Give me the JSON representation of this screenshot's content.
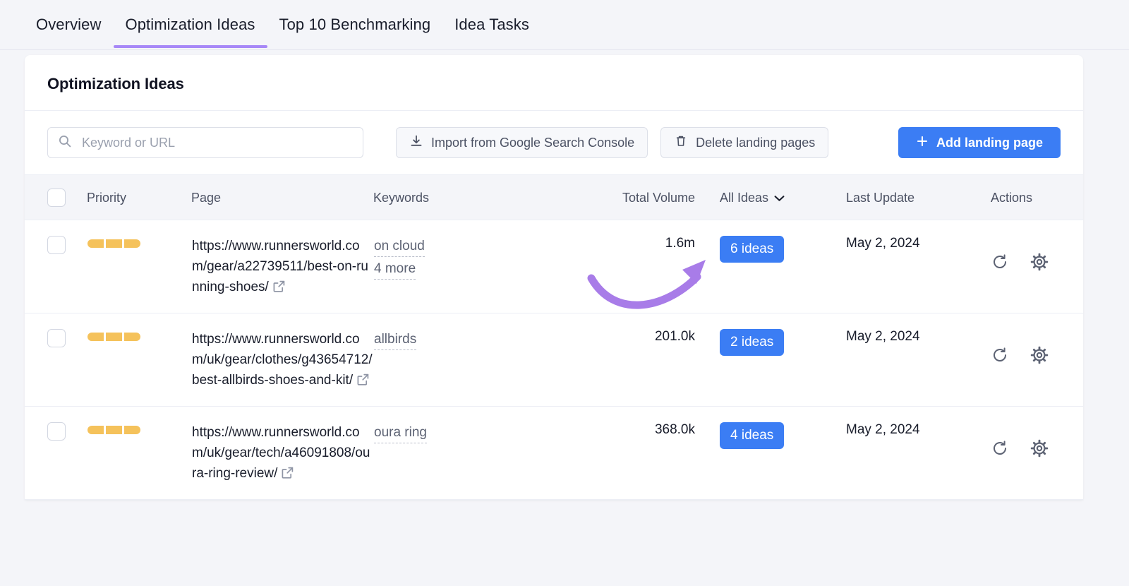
{
  "tabs": [
    {
      "label": "Overview",
      "active": false
    },
    {
      "label": "Optimization Ideas",
      "active": true
    },
    {
      "label": "Top 10 Benchmarking",
      "active": false
    },
    {
      "label": "Idea Tasks",
      "active": false
    }
  ],
  "card": {
    "title": "Optimization Ideas"
  },
  "toolbar": {
    "search_placeholder": "Keyword or URL",
    "search_value": "",
    "search_icon": "search-icon",
    "import_label": "Import from Google Search Console",
    "import_icon": "download-icon",
    "delete_label": "Delete landing pages",
    "delete_icon": "trash-icon",
    "add_label": "Add landing page",
    "add_icon": "plus-icon",
    "accent_blue": "#3b7df4"
  },
  "table": {
    "headers": {
      "priority": "Priority",
      "page": "Page",
      "keywords": "Keywords",
      "total_volume": "Total Volume",
      "ideas_filter": "All Ideas",
      "ideas_filter_icon": "chevron-down-icon",
      "last_update": "Last Update",
      "actions": "Actions"
    },
    "rows": [
      {
        "priority_filled": 3,
        "priority_total": 3,
        "url": "https://www.runnersworld.com/gear/a22739511/best-on-running-shoes/",
        "keywords": [
          "on cloud",
          "4 more"
        ],
        "total_volume": "1.6m",
        "ideas": "6 ideas",
        "last_update": "May 2, 2024",
        "actions": [
          "refresh-icon",
          "gear-icon"
        ]
      },
      {
        "priority_filled": 3,
        "priority_total": 3,
        "url": "https://www.runnersworld.com/uk/gear/clothes/g43654712/best-allbirds-shoes-and-kit/",
        "keywords": [
          "allbirds"
        ],
        "total_volume": "201.0k",
        "ideas": "2 ideas",
        "last_update": "May 2, 2024",
        "actions": [
          "refresh-icon",
          "gear-icon"
        ]
      },
      {
        "priority_filled": 3,
        "priority_total": 3,
        "url": "https://www.runnersworld.com/uk/gear/tech/a46091808/oura-ring-review/",
        "keywords": [
          "oura ring"
        ],
        "total_volume": "368.0k",
        "ideas": "4 ideas",
        "last_update": "May 2, 2024",
        "actions": [
          "refresh-icon",
          "gear-icon"
        ]
      }
    ]
  },
  "annotation": {
    "arrow_color": "#a87ce8",
    "points_to": "6 ideas"
  }
}
